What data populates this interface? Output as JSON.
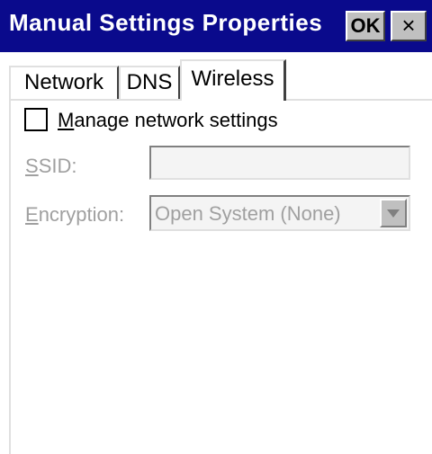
{
  "window": {
    "title": "Manual Settings Properties",
    "ok_label": "OK",
    "close_label": "×"
  },
  "tabs": [
    {
      "label": "Network",
      "active": false
    },
    {
      "label": "DNS",
      "active": false
    },
    {
      "label": "Wireless",
      "active": true
    }
  ],
  "manage": {
    "checked": false,
    "label_mnemonic": "M",
    "label_rest": "anage network settings"
  },
  "ssid": {
    "label_mnemonic": "S",
    "label_rest": "SID:",
    "value": "",
    "enabled": false
  },
  "encryption": {
    "label_mnemonic": "E",
    "label_rest": "ncryption:",
    "selected": "Open System (None)",
    "enabled": false
  },
  "colors": {
    "title_bar": "#0a0a8c",
    "button_face": "#c0c0c0",
    "disabled_text": "#a0a0a0"
  }
}
